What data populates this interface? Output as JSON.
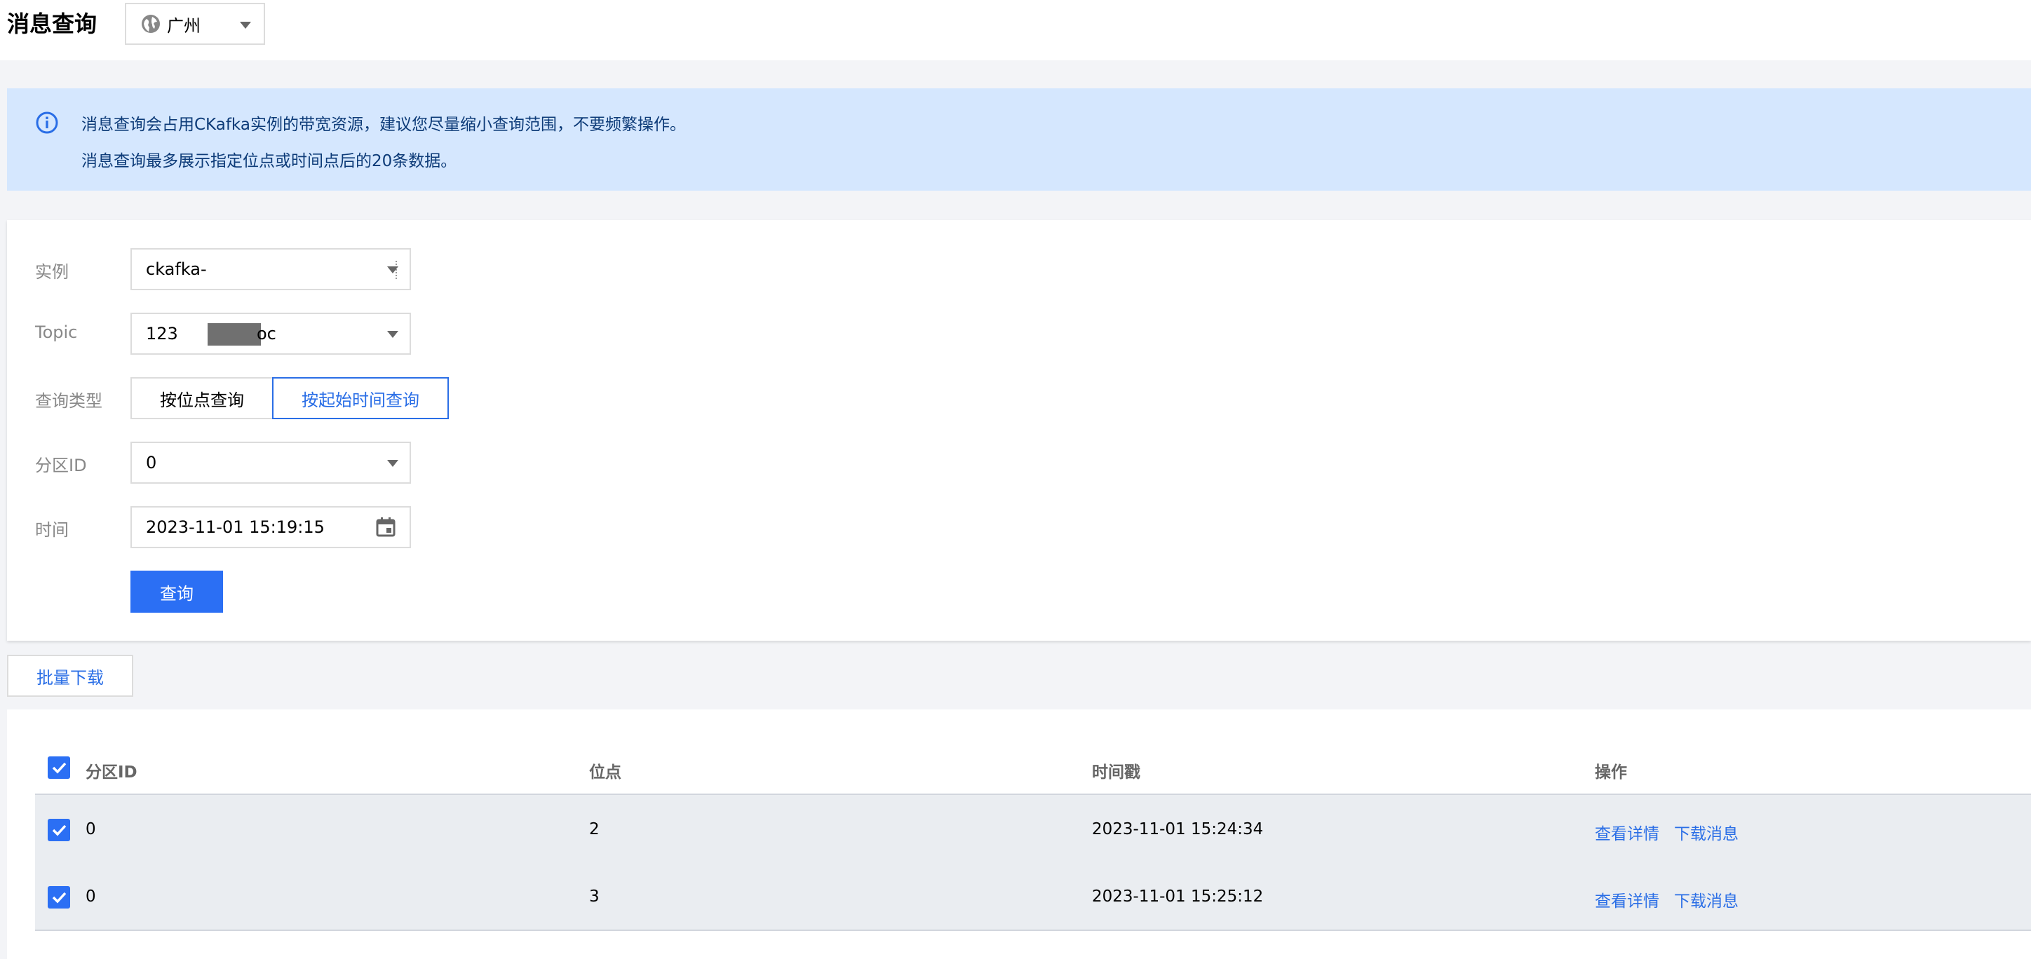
{
  "header": {
    "title": "消息查询",
    "region": "广州"
  },
  "notice": {
    "line1": "消息查询会占用CKafka实例的带宽资源，建议您尽量缩小查询范围，不要频繁操作。",
    "line2": "消息查询最多展示指定位点或时间点后的20条数据。"
  },
  "form": {
    "instance_label": "实例",
    "instance_value": "ckafka-",
    "topic_label": "Topic",
    "topic_value_prefix": "123",
    "topic_value_suffix": "oc",
    "query_type_label": "查询类型",
    "query_type_options": [
      "按位点查询",
      "按起始时间查询"
    ],
    "query_type_selected": "按起始时间查询",
    "partition_label": "分区ID",
    "partition_value": "0",
    "time_label": "时间",
    "time_value": "2023-11-01 15:19:15",
    "submit_label": "查询"
  },
  "batch_download_label": "批量下载",
  "table": {
    "columns": [
      "分区ID",
      "位点",
      "时间戳",
      "操作"
    ],
    "rows": [
      {
        "partition": "0",
        "offset": "2",
        "timestamp": "2023-11-01 15:24:34",
        "action_view": "查看详情",
        "action_download": "下载消息"
      },
      {
        "partition": "0",
        "offset": "3",
        "timestamp": "2023-11-01 15:25:12",
        "action_view": "查看详情",
        "action_download": "下载消息"
      }
    ]
  },
  "colors": {
    "accent": "#2b6ff4",
    "notice_bg": "#d5e7fe",
    "row_bg": "#eaedf1"
  }
}
